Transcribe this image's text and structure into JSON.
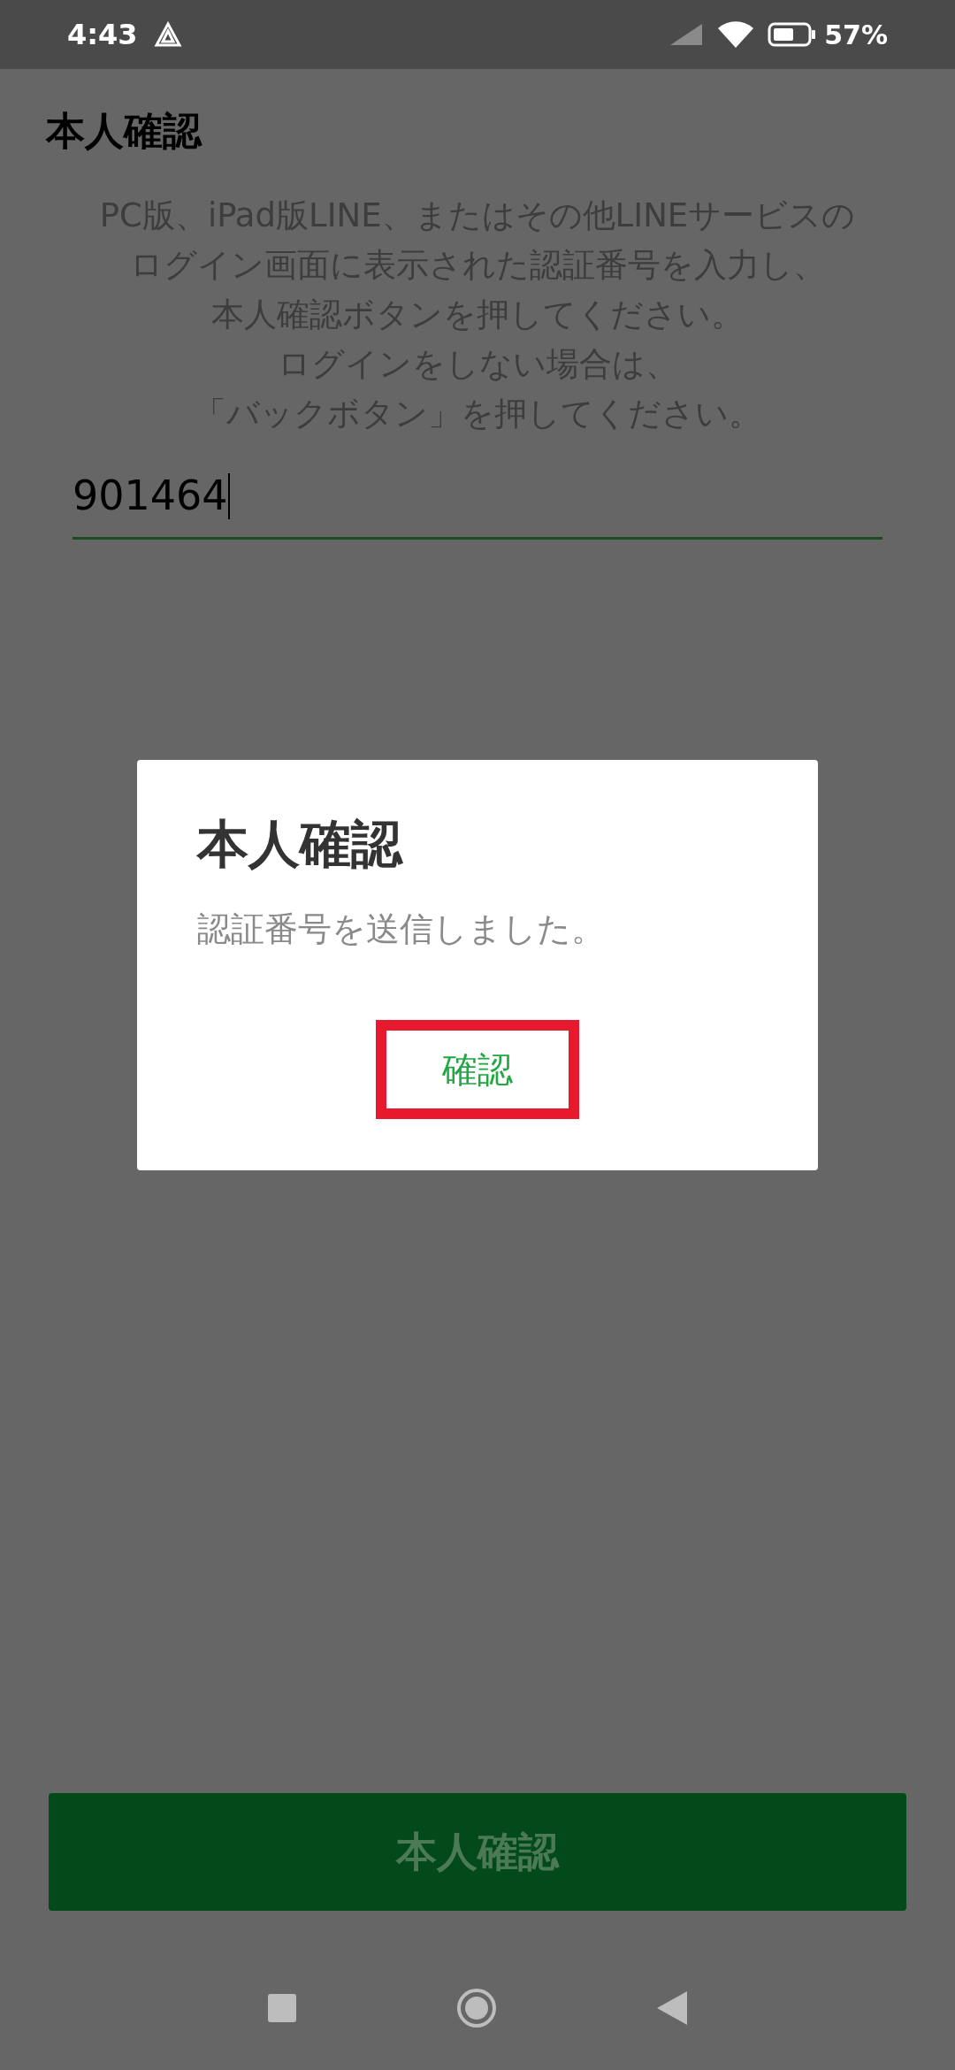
{
  "status_bar": {
    "time": "4:43",
    "battery": "57%"
  },
  "title": "本人確認",
  "instructions": [
    "PC版、iPad版LINE、またはその他LINEサービスの",
    "ログイン画面に表示された認証番号を入力し、",
    "本人確認ボタンを押してください。",
    "ログインをしない場合は、",
    "「バックボタン」を押してください。"
  ],
  "code_field": {
    "value": "901464",
    "focused": true
  },
  "dialog": {
    "title": "本人確認",
    "message": "認証番号を送信しました。",
    "button": {
      "label": "確認",
      "highlighted": true
    }
  },
  "confirm_button": {
    "label": "本人確認",
    "disabled": true
  }
}
